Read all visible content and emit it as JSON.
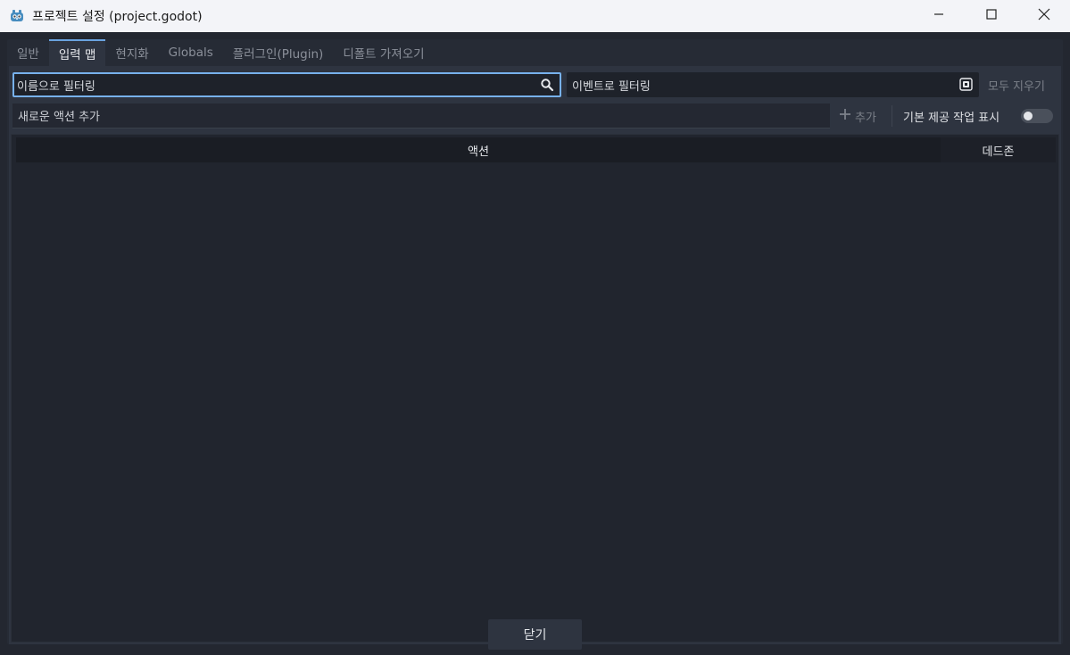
{
  "window": {
    "title": "프로젝트 설정 (project.godot)",
    "icon": "godot-icon",
    "controls": [
      "minimize-icon",
      "maximize-icon",
      "close-icon"
    ]
  },
  "tabs": [
    {
      "label": "일반",
      "active": false
    },
    {
      "label": "입력 맵",
      "active": true
    },
    {
      "label": "현지화",
      "active": false
    },
    {
      "label": "Globals",
      "active": false
    },
    {
      "label": "플러그인(Plugin)",
      "active": false
    },
    {
      "label": "디폴트 가져오기",
      "active": false
    }
  ],
  "filters": {
    "name_value": "이름으로 필터링",
    "event_value": "이벤트로 필터링",
    "clear_all_label": "모두 지우기"
  },
  "new_action": {
    "value": "새로운 액션 추가",
    "add_label": "추가"
  },
  "builtin": {
    "label": "기본 제공 작업 표시",
    "enabled": false
  },
  "tree": {
    "columns": [
      "액션",
      "데드존"
    ],
    "rows": []
  },
  "footer": {
    "close_label": "닫기"
  },
  "colors": {
    "accent": "#77b1ec",
    "background": "#232730",
    "panel": "#2e3440"
  }
}
